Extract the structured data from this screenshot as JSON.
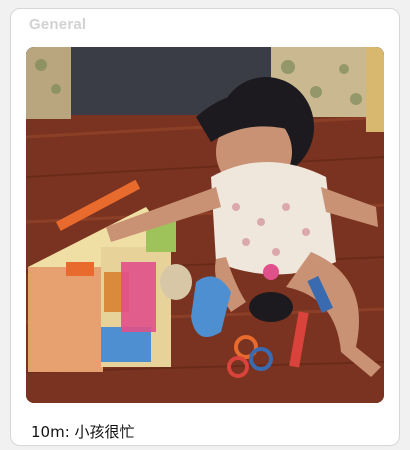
{
  "section": {
    "title": "General"
  },
  "photo": {
    "subject": "baby-playing-with-toys",
    "colors": {
      "floor": "#7a3320",
      "floor_stripe": "#8f4028",
      "sofa": "#3a3c46",
      "sofa_pattern": "#c9b890",
      "toy_house": "#e7d39a",
      "toy_orange": "#e86a2c",
      "toy_blue": "#4d8fd0",
      "toy_pink": "#e0508a",
      "skin": "#c99274",
      "hair": "#1c1a1e"
    }
  },
  "caption": {
    "text": "10m: 小孩很忙"
  }
}
